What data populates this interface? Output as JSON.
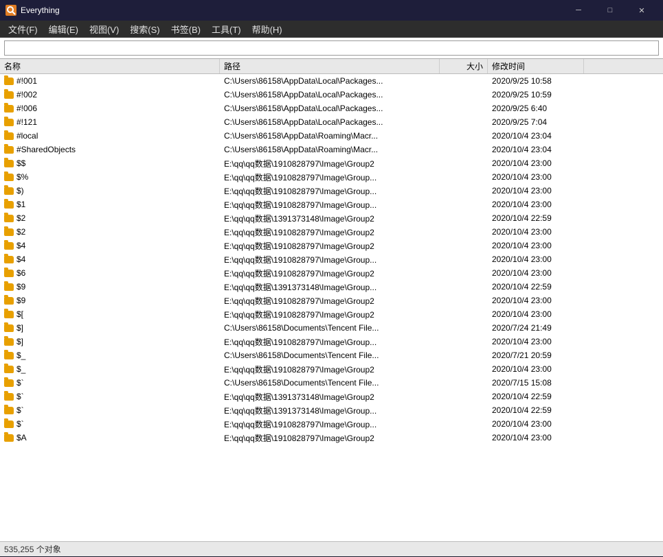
{
  "titlebar": {
    "title": "Everything",
    "app_icon": "E",
    "minimize": "─",
    "maximize": "□",
    "close": "✕"
  },
  "menubar": {
    "items": [
      {
        "label": "文件(F)"
      },
      {
        "label": "编辑(E)"
      },
      {
        "label": "视图(V)"
      },
      {
        "label": "搜索(S)"
      },
      {
        "label": "书签(B)"
      },
      {
        "label": "工具(T)"
      },
      {
        "label": "帮助(H)"
      }
    ]
  },
  "search": {
    "placeholder": "",
    "value": ""
  },
  "columns": {
    "name": "名称",
    "path": "路径",
    "size": "大小",
    "modified": "修改时间"
  },
  "files": [
    {
      "name": "#!001",
      "path": "C:\\Users\\86158\\AppData\\Local\\Packages...",
      "size": "",
      "modified": "2020/9/25 10:58"
    },
    {
      "name": "#!002",
      "path": "C:\\Users\\86158\\AppData\\Local\\Packages...",
      "size": "",
      "modified": "2020/9/25 10:59"
    },
    {
      "name": "#!006",
      "path": "C:\\Users\\86158\\AppData\\Local\\Packages...",
      "size": "",
      "modified": "2020/9/25 6:40"
    },
    {
      "name": "#!121",
      "path": "C:\\Users\\86158\\AppData\\Local\\Packages...",
      "size": "",
      "modified": "2020/9/25 7:04"
    },
    {
      "name": "#local",
      "path": "C:\\Users\\86158\\AppData\\Roaming\\Macr...",
      "size": "",
      "modified": "2020/10/4 23:04"
    },
    {
      "name": "#SharedObjects",
      "path": "C:\\Users\\86158\\AppData\\Roaming\\Macr...",
      "size": "",
      "modified": "2020/10/4 23:04"
    },
    {
      "name": "$$",
      "path": "E:\\qq\\qq数据\\1910828797\\Image\\Group2",
      "size": "",
      "modified": "2020/10/4 23:00"
    },
    {
      "name": "$%",
      "path": "E:\\qq\\qq数据\\1910828797\\Image\\Group...",
      "size": "",
      "modified": "2020/10/4 23:00"
    },
    {
      "name": "$)",
      "path": "E:\\qq\\qq数据\\1910828797\\Image\\Group...",
      "size": "",
      "modified": "2020/10/4 23:00"
    },
    {
      "name": "$1",
      "path": "E:\\qq\\qq数据\\1910828797\\Image\\Group...",
      "size": "",
      "modified": "2020/10/4 23:00"
    },
    {
      "name": "$2",
      "path": "E:\\qq\\qq数据\\1391373148\\Image\\Group2",
      "size": "",
      "modified": "2020/10/4 22:59"
    },
    {
      "name": "$2",
      "path": "E:\\qq\\qq数据\\1910828797\\Image\\Group2",
      "size": "",
      "modified": "2020/10/4 23:00"
    },
    {
      "name": "$4",
      "path": "E:\\qq\\qq数据\\1910828797\\Image\\Group2",
      "size": "",
      "modified": "2020/10/4 23:00"
    },
    {
      "name": "$4",
      "path": "E:\\qq\\qq数据\\1910828797\\Image\\Group...",
      "size": "",
      "modified": "2020/10/4 23:00"
    },
    {
      "name": "$6",
      "path": "E:\\qq\\qq数据\\1910828797\\Image\\Group2",
      "size": "",
      "modified": "2020/10/4 23:00"
    },
    {
      "name": "$9",
      "path": "E:\\qq\\qq数据\\1391373148\\Image\\Group...",
      "size": "",
      "modified": "2020/10/4 22:59"
    },
    {
      "name": "$9",
      "path": "E:\\qq\\qq数据\\1910828797\\Image\\Group2",
      "size": "",
      "modified": "2020/10/4 23:00"
    },
    {
      "name": "$[",
      "path": "E:\\qq\\qq数据\\1910828797\\Image\\Group2",
      "size": "",
      "modified": "2020/10/4 23:00"
    },
    {
      "name": "$]",
      "path": "C:\\Users\\86158\\Documents\\Tencent File...",
      "size": "",
      "modified": "2020/7/24 21:49"
    },
    {
      "name": "$]",
      "path": "E:\\qq\\qq数据\\1910828797\\Image\\Group...",
      "size": "",
      "modified": "2020/10/4 23:00"
    },
    {
      "name": "$_",
      "path": "C:\\Users\\86158\\Documents\\Tencent File...",
      "size": "",
      "modified": "2020/7/21 20:59"
    },
    {
      "name": "$_",
      "path": "E:\\qq\\qq数据\\1910828797\\Image\\Group2",
      "size": "",
      "modified": "2020/10/4 23:00"
    },
    {
      "name": "$`",
      "path": "C:\\Users\\86158\\Documents\\Tencent File...",
      "size": "",
      "modified": "2020/7/15 15:08"
    },
    {
      "name": "$`",
      "path": "E:\\qq\\qq数据\\1391373148\\Image\\Group2",
      "size": "",
      "modified": "2020/10/4 22:59"
    },
    {
      "name": "$`",
      "path": "E:\\qq\\qq数据\\1391373148\\Image\\Group...",
      "size": "",
      "modified": "2020/10/4 22:59"
    },
    {
      "name": "$`",
      "path": "E:\\qq\\qq数据\\1910828797\\Image\\Group...",
      "size": "",
      "modified": "2020/10/4 23:00"
    },
    {
      "name": "$A",
      "path": "E:\\qq\\qq数据\\1910828797\\Image\\Group2",
      "size": "",
      "modified": "2020/10/4 23:00"
    }
  ],
  "statusbar": {
    "text": "535,255 个对象"
  }
}
